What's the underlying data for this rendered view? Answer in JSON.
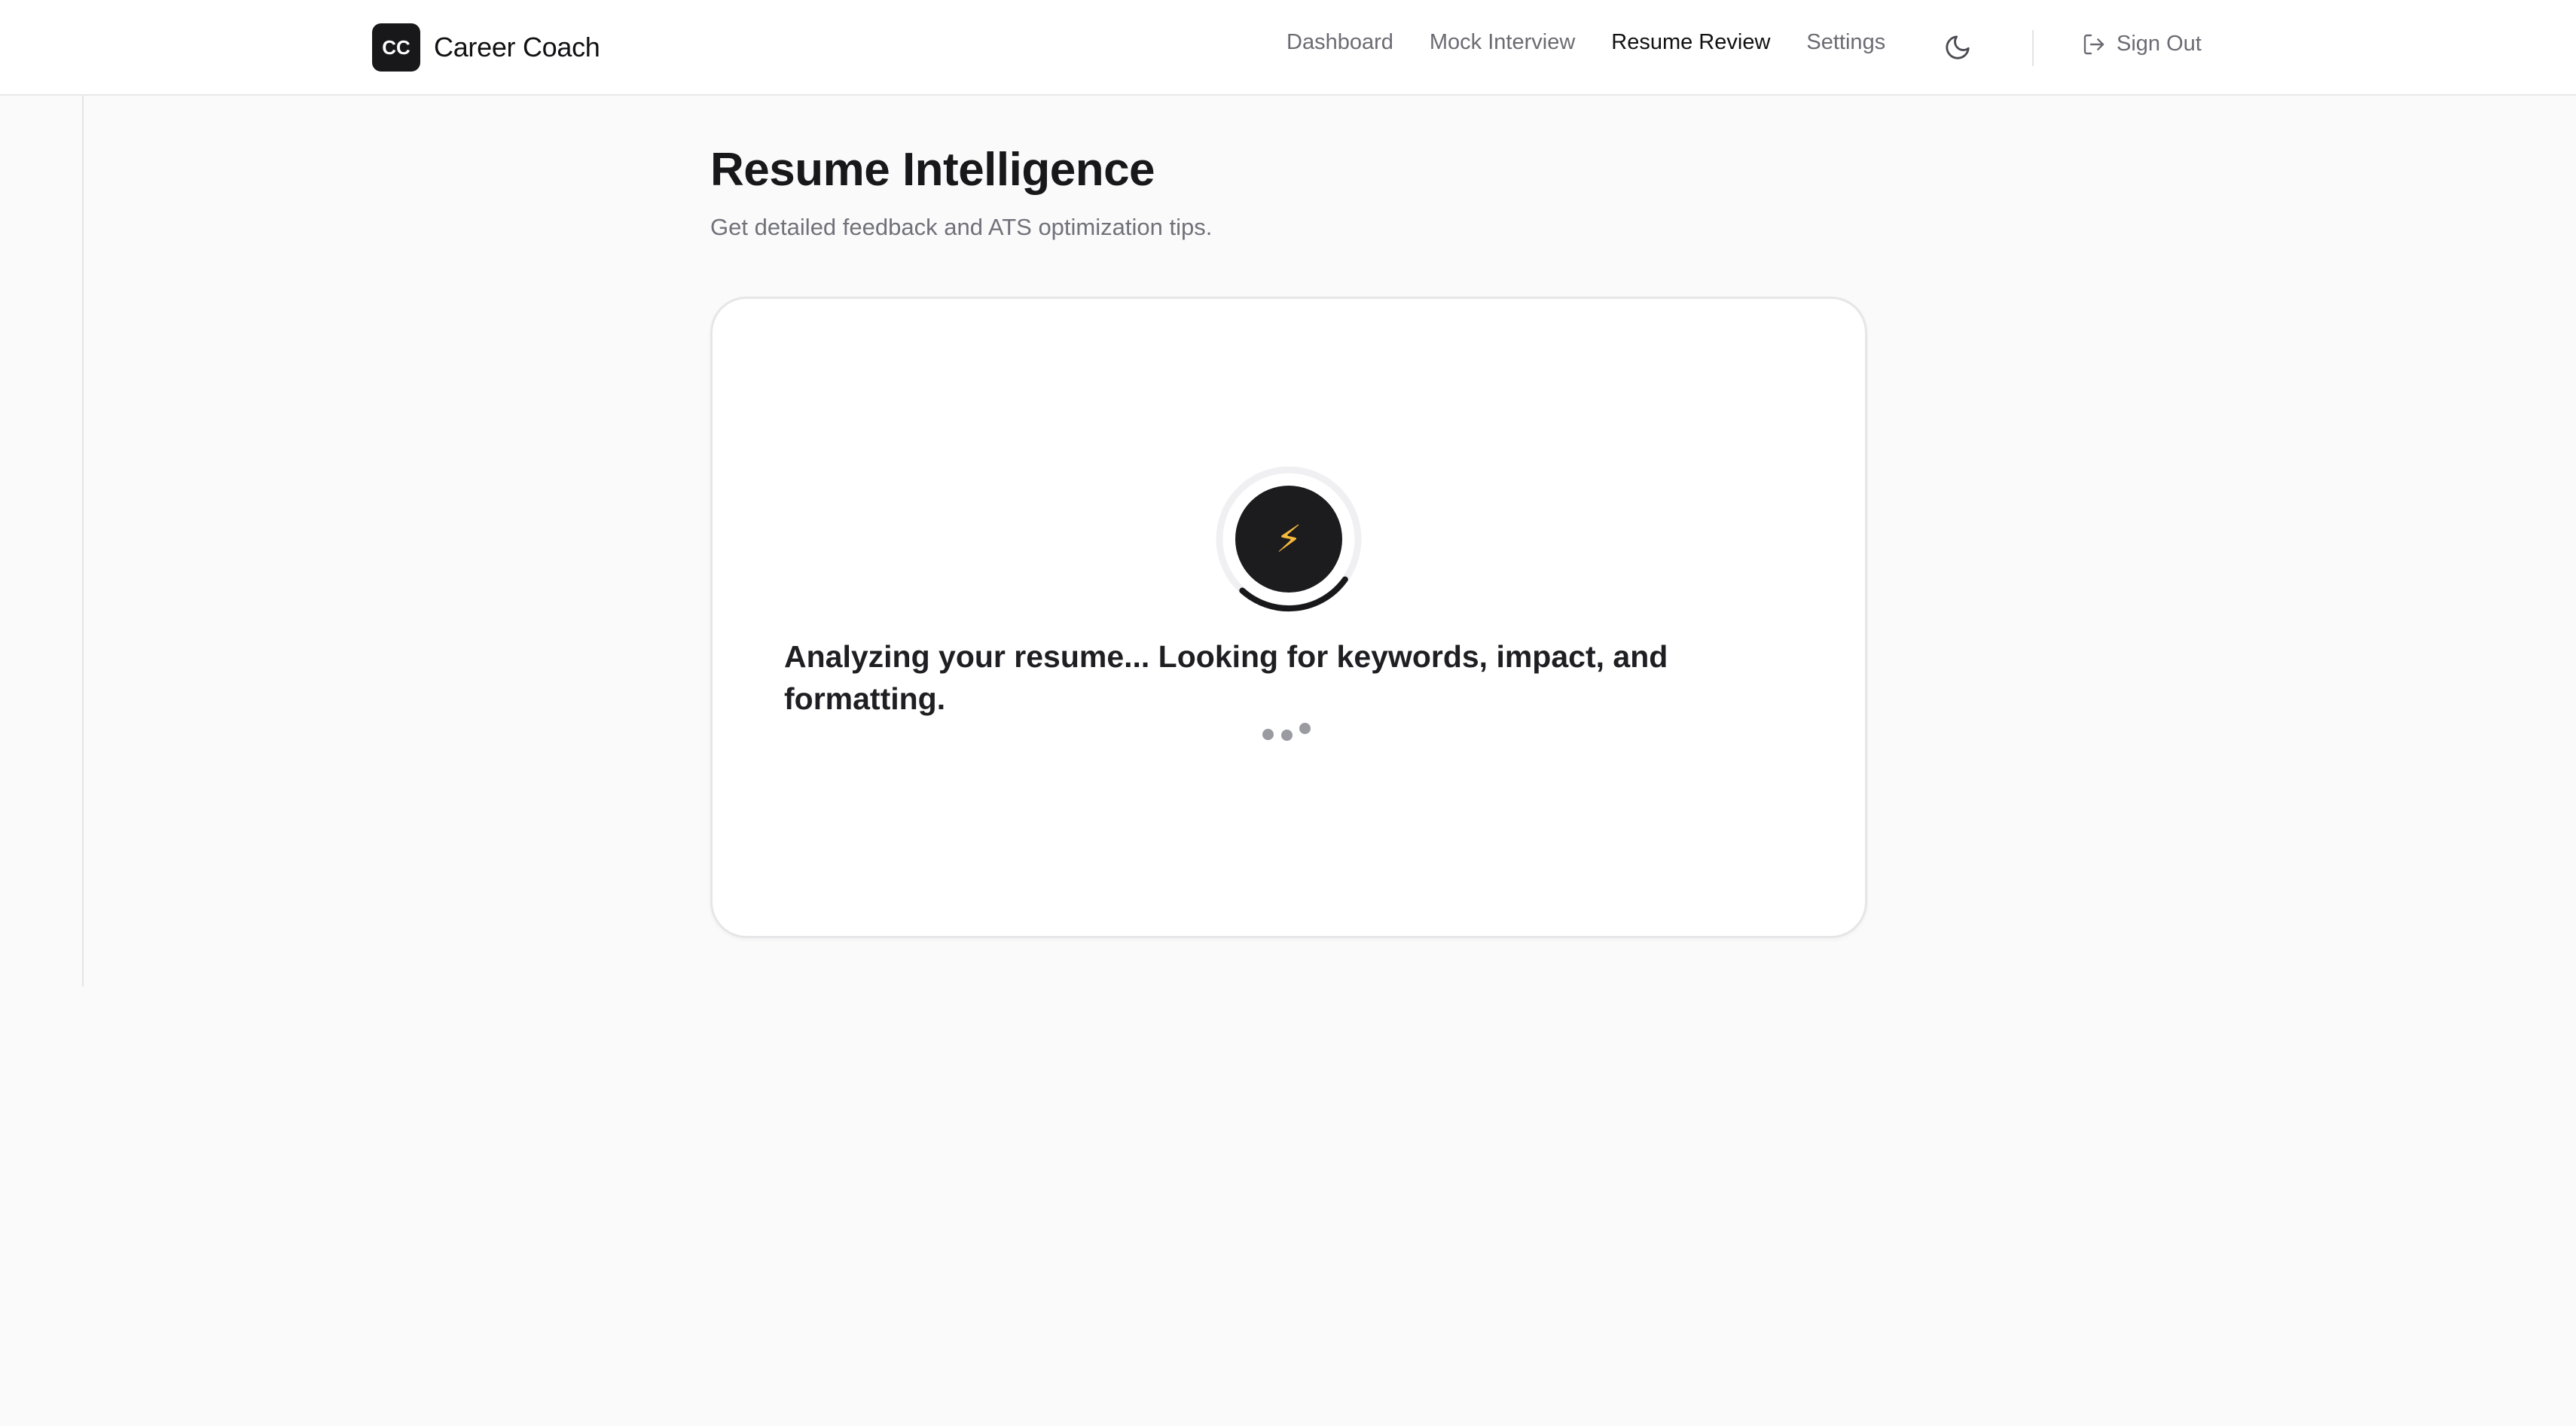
{
  "header": {
    "logo_text": "CC",
    "brand_name": "Career Coach",
    "nav": [
      {
        "label": "Dashboard",
        "active": false
      },
      {
        "label": "Mock Interview",
        "active": false
      },
      {
        "label": "Resume Review",
        "active": true
      },
      {
        "label": "Settings",
        "active": false
      }
    ],
    "theme_toggle_icon": "moon-icon",
    "sign_out_label": "Sign Out",
    "sign_out_icon": "log-out-icon"
  },
  "page": {
    "title": "Resume Intelligence",
    "subtitle": "Get detailed feedback and ATS optimization tips."
  },
  "loading": {
    "icon": "lightning-icon",
    "icon_glyph": "⚡",
    "message": "Analyzing your resume... Looking for keywords, impact, and formatting."
  },
  "colors": {
    "accent": "#18181b",
    "bolt": "#f6b93b",
    "background": "#fafafa"
  }
}
